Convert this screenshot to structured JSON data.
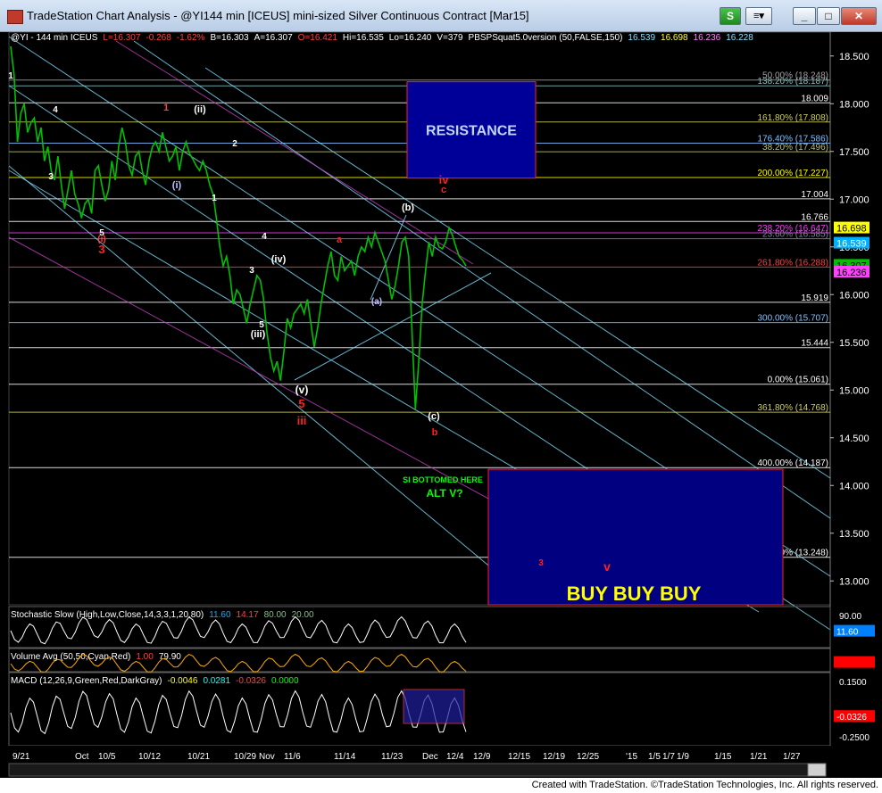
{
  "window": {
    "title": "TradeStation Chart Analysis - @YI144 min [ICEUS] mini-sized Silver Continuous Contract [Mar15]",
    "btn_s": "S",
    "btn_minimize": "_",
    "btn_restore": "□",
    "btn_close": "✕"
  },
  "footer": {
    "text": "Created with TradeStation. ©TradeStation Technologies, Inc. All rights reserved."
  },
  "colors": {
    "background": "#000000",
    "price": "#00c000",
    "resistance_box": "#000099",
    "buy_box": "#000080",
    "box_border": "#ff2020",
    "fib_line": "#ffffff",
    "channel_cyan": "#80e0ff",
    "channel_magenta": "#c040c0",
    "wave_red": "#ff2020"
  },
  "chart_data": {
    "type": "line",
    "symbol_header": {
      "symbol": "@YI - 144 min ICEUS",
      "items": [
        {
          "text": "L=16.307",
          "color": "#ff4040"
        },
        {
          "text": "-0.268",
          "color": "#ff4040"
        },
        {
          "text": "-1.62%",
          "color": "#ff4040"
        },
        {
          "text": "B=16.303",
          "color": "#ffffff"
        },
        {
          "text": "A=16.307",
          "color": "#ffffff"
        },
        {
          "text": "O=16.421",
          "color": "#ff4040"
        },
        {
          "text": "Hi=16.535",
          "color": "#ffffff"
        },
        {
          "text": "Lo=16.240",
          "color": "#ffffff"
        },
        {
          "text": "V=379",
          "color": "#ffffff"
        },
        {
          "text": "PBSPSquat5.0version (50,FALSE,150)",
          "color": "#ffffff"
        },
        {
          "text": "16.539",
          "color": "#80e0ff"
        },
        {
          "text": "16.698",
          "color": "#ffff40"
        },
        {
          "text": "16.236",
          "color": "#ff80ff"
        },
        {
          "text": "16.228",
          "color": "#80e0ff"
        }
      ]
    },
    "price_axis": {
      "min": 12.75,
      "max": 18.75,
      "ticks": [
        13.0,
        13.5,
        14.0,
        14.5,
        15.0,
        15.5,
        16.0,
        16.5,
        17.0,
        17.5,
        18.0,
        18.5
      ],
      "tick_labels": [
        "13.000",
        "13.500",
        "14.000",
        "14.500",
        "15.000",
        "15.500",
        "16.000",
        "16.500",
        "17.000",
        "17.500",
        "18.000",
        "18.500"
      ]
    },
    "price_tags": [
      {
        "value": 16.698,
        "label": "16.698",
        "bg": "#ffff00",
        "fg": "#000000"
      },
      {
        "value": 16.539,
        "label": "16.539",
        "bg": "#00b0ff",
        "fg": "#ffffff"
      },
      {
        "value": 16.307,
        "label": "16.307",
        "bg": "#00c000",
        "fg": "#000000"
      },
      {
        "value": 16.236,
        "label": "16.236",
        "bg": "#ff40ff",
        "fg": "#000000"
      }
    ],
    "price_series": [
      18.6,
      18.3,
      17.6,
      17.9,
      18.0,
      17.7,
      17.8,
      17.85,
      17.6,
      17.75,
      17.4,
      17.55,
      17.3,
      17.2,
      17.45,
      17.15,
      16.9,
      17.1,
      17.3,
      17.05,
      16.95,
      16.8,
      16.95,
      17.0,
      16.85,
      17.3,
      17.35,
      17.15,
      16.98,
      17.1,
      17.4,
      17.2,
      17.55,
      17.75,
      17.6,
      17.35,
      17.25,
      17.45,
      17.5,
      17.3,
      17.15,
      17.4,
      17.55,
      17.6,
      17.5,
      17.7,
      17.55,
      17.4,
      17.45,
      17.55,
      17.3,
      17.5,
      17.6,
      17.48,
      17.42,
      17.35,
      17.3,
      17.4,
      17.3,
      17.15,
      17.05,
      16.8,
      16.5,
      16.3,
      16.4,
      16.2,
      15.9,
      16.05,
      16.0,
      15.85,
      15.7,
      15.9,
      16.05,
      16.2,
      16.15,
      15.95,
      15.6,
      15.35,
      15.2,
      15.3,
      15.1,
      15.4,
      15.75,
      15.65,
      15.8,
      15.85,
      15.9,
      15.8,
      15.95,
      15.7,
      15.45,
      15.65,
      15.9,
      16.1,
      16.3,
      16.45,
      16.2,
      16.15,
      16.4,
      16.25,
      16.3,
      16.35,
      16.2,
      16.4,
      16.5,
      16.45,
      16.6,
      16.5,
      16.65,
      16.55,
      16.45,
      16.35,
      16.15,
      15.95,
      16.1,
      16.3,
      16.55,
      16.6,
      16.4,
      15.6,
      14.8,
      15.3,
      15.9,
      16.25,
      16.55,
      16.4,
      16.6,
      16.5,
      16.48,
      16.55,
      16.7,
      16.62,
      16.5,
      16.4,
      16.36,
      16.3
    ],
    "price_series_end_date": "12/4",
    "x_axis": {
      "ticks": [
        "9/21",
        "Oct",
        "10/5",
        "10/12",
        "10/21",
        "10/29",
        "Nov",
        "11/6",
        "11/14",
        "11/23",
        "Dec",
        "12/4",
        "12/9",
        "12/15",
        "12/19",
        "12/25",
        "'15",
        "1/5",
        "1/7",
        "1/9",
        "1/15",
        "1/21",
        "1/27"
      ]
    },
    "horizontal_levels": [
      {
        "value": 18.248,
        "label": "50.00% (18.248)",
        "color": "#a0a0a0"
      },
      {
        "value": 18.187,
        "label": "138.20% (18.187)",
        "color": "#80c0c0"
      },
      {
        "value": 18.009,
        "label": "18.009",
        "color": "#ffffff"
      },
      {
        "value": 17.808,
        "label": "161.80% (17.808)",
        "color": "#d0d060"
      },
      {
        "value": 17.586,
        "label": "176.40% (17.586)",
        "color": "#80c0ff"
      },
      {
        "value": 17.496,
        "label": "38.20% (17.496)",
        "color": "#c0c070"
      },
      {
        "value": 17.227,
        "label": "200.00% (17.227)",
        "color": "#ffff00"
      },
      {
        "value": 17.004,
        "label": "17.004",
        "color": "#ffffff"
      },
      {
        "value": 16.766,
        "label": "16.766",
        "color": "#ffffff"
      },
      {
        "value": 16.647,
        "label": "238.20% (16.647)",
        "color": "#ff40ff"
      },
      {
        "value": 16.585,
        "label": "23.60% (16.585)",
        "color": "#8080a0"
      },
      {
        "value": 16.288,
        "label": "261.80% (16.288)",
        "color": "#ff4040"
      },
      {
        "value": 15.919,
        "label": "15.919",
        "color": "#ffffff"
      },
      {
        "value": 15.707,
        "label": "300.00% (15.707)",
        "color": "#80c0ff"
      },
      {
        "value": 15.444,
        "label": "15.444",
        "color": "#ffffff"
      },
      {
        "value": 15.061,
        "label": "0.00% (15.061)",
        "color": "#ffffff"
      },
      {
        "value": 14.768,
        "label": "361.80% (14.768)",
        "color": "#d0d060"
      },
      {
        "value": 14.187,
        "label": "400.00% (14.187)",
        "color": "#ffffff"
      },
      {
        "value": 13.248,
        "label": "461.80% (13.248)",
        "color": "#ffffff"
      }
    ],
    "resistance_box": {
      "label": "RESISTANCE",
      "price_top": 18.23,
      "price_bottom": 17.22
    },
    "buy_box": {
      "label": "BUY BUY BUY",
      "price_top": 14.17,
      "price_bottom": 12.75
    },
    "annotations": [
      {
        "text": "SI BOTTOMED HERE",
        "color": "#00ff00"
      },
      {
        "text": "ALT V?",
        "color": "#00ff00"
      }
    ],
    "wave_labels": [
      {
        "text": "1",
        "color": "#ffffff"
      },
      {
        "text": "4",
        "color": "#ffffff"
      },
      {
        "text": "3",
        "color": "#ffffff"
      },
      {
        "text": "5",
        "color": "#ffffff"
      },
      {
        "text": "(i)",
        "color": "#ff4040"
      },
      {
        "text": "3",
        "color": "#ff2020"
      },
      {
        "text": "1",
        "color": "#ff4040"
      },
      {
        "text": "(ii)",
        "color": "#ffffff"
      },
      {
        "text": "(i)",
        "color": "#c0c0ff"
      },
      {
        "text": "1",
        "color": "#ffffff"
      },
      {
        "text": "2",
        "color": "#ffffff"
      },
      {
        "text": "4",
        "color": "#ffffff"
      },
      {
        "text": "3",
        "color": "#ffffff"
      },
      {
        "text": "(iv)",
        "color": "#ffffff"
      },
      {
        "text": "5",
        "color": "#ffffff"
      },
      {
        "text": "(iii)",
        "color": "#ffffff"
      },
      {
        "text": "(v)",
        "color": "#ffffff"
      },
      {
        "text": "5",
        "color": "#ff2020"
      },
      {
        "text": "iii",
        "color": "#ff2020"
      },
      {
        "text": "a",
        "color": "#ff2020"
      },
      {
        "text": "(b)",
        "color": "#ffffff"
      },
      {
        "text": "(a)",
        "color": "#c0c0ff"
      },
      {
        "text": "iv",
        "color": "#ff2020"
      },
      {
        "text": "c",
        "color": "#ff2020"
      },
      {
        "text": "(c)",
        "color": "#ffffff"
      },
      {
        "text": "b",
        "color": "#ff2020"
      },
      {
        "text": "3",
        "color": "#ff2020"
      },
      {
        "text": "v",
        "color": "#ff2020"
      }
    ],
    "panels": [
      {
        "name": "stochastic",
        "title": "Stochastic Slow (High,Low,Close,14,3,3,1,20,80)",
        "values": [
          {
            "text": "11.60",
            "color": "#00b0ff"
          },
          {
            "text": "14.17",
            "color": "#ff4040"
          },
          {
            "text": "80.00",
            "color": "#80c080"
          },
          {
            "text": "20.00",
            "color": "#80c080"
          }
        ],
        "axis_labels": [
          "90.00"
        ],
        "tag": {
          "label": "11.60",
          "bg": "#0080ff"
        }
      },
      {
        "name": "volume",
        "title": "Volume Avg (50,50,Cyan,Red)",
        "values": [
          {
            "text": "1.00",
            "color": "#ff4040"
          },
          {
            "text": "79.90",
            "color": "#ffffff"
          }
        ],
        "axis_labels": [],
        "tag": {
          "label": "",
          "bg": "#ff0000"
        }
      },
      {
        "name": "macd",
        "title": "MACD (12,26,9,Green,Red,DarkGray)",
        "values": [
          {
            "text": "-0.0046",
            "color": "#ffff00"
          },
          {
            "text": "0.0281",
            "color": "#00ffff"
          },
          {
            "text": "-0.0326",
            "color": "#ff4040"
          },
          {
            "text": "0.0000",
            "color": "#00ff00"
          }
        ],
        "axis_labels": [
          "0.1500",
          "-0.2500"
        ],
        "tag": {
          "label": "-0.0326",
          "bg": "#ff0000"
        }
      }
    ]
  }
}
